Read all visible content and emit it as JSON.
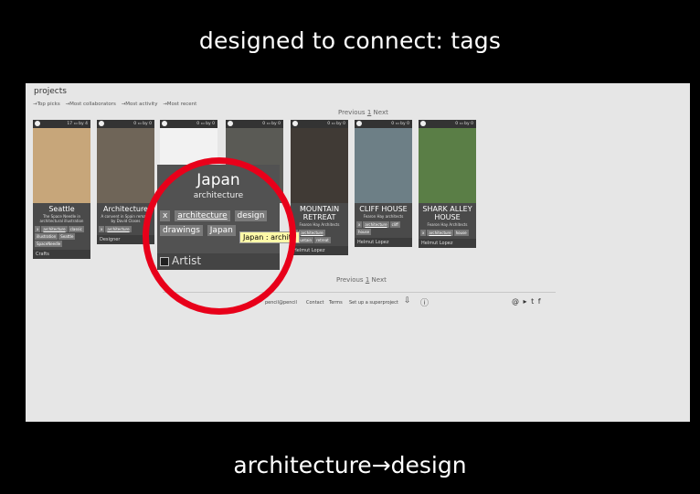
{
  "slide": {
    "title": "designed to connect: tags",
    "caption": "architecture→design"
  },
  "page": {
    "heading": "projects",
    "filters": [
      "→Top picks",
      "→Most collaborators",
      "→Most activity",
      "→Most recent"
    ],
    "pager": {
      "prev": "Previous",
      "page": "1",
      "next": "Next"
    }
  },
  "cards": [
    {
      "stats": "17 ▭ by 4",
      "name": "Seattle",
      "desc": "The Space Needle in architectural illustration",
      "tags": [
        "x",
        "architecture",
        "classic",
        "illustration",
        "Seattle",
        "SpaceNeedle"
      ],
      "foot": "Crafts",
      "img": "#c7a67a"
    },
    {
      "stats": "0 ▭ by 0",
      "name": "Architecture",
      "desc": "A convent in Spain remade by David Closes",
      "tags": [
        "x",
        "architecture"
      ],
      "foot": "Designer",
      "img": "#6f6558"
    },
    {
      "stats": "0 ▭ by 0",
      "name": "",
      "desc": "",
      "tags": [],
      "foot": "",
      "img": "#f2f2f2"
    },
    {
      "stats": "0 ▭ by 0",
      "name": "",
      "desc": "",
      "tags": [],
      "foot": "",
      "img": "#5a5a55"
    },
    {
      "stats": "0 ▭ by 0",
      "name": "MOUNTAIN RETREAT",
      "desc": "Fearon Hay Architects",
      "tags": [
        "x",
        "architecture",
        "mountain",
        "retreat"
      ],
      "foot": "Helmut Lopez",
      "img": "#403a35"
    },
    {
      "stats": "0 ▭ by 0",
      "name": "CLIFF HOUSE",
      "desc": "Fearon Hay architects",
      "tags": [
        "x",
        "architecture",
        "cliff",
        "house"
      ],
      "foot": "Helmut Lopez",
      "img": "#6d7f86"
    },
    {
      "stats": "0 ▭ by 0",
      "name": "SHARK ALLEY HOUSE",
      "desc": "Fearon Hay Architects",
      "tags": [
        "x",
        "architecture",
        "house"
      ],
      "foot": "Helmut Lopez",
      "img": "#5a7e46"
    }
  ],
  "zoom": {
    "name": "Japan",
    "subtitle": "architecture",
    "tags": [
      "x",
      "architecture",
      "design",
      "drawings",
      "Japan"
    ],
    "foot": "Artist",
    "tooltip": "Japan : archite"
  },
  "footer": {
    "links": [
      "pencil@pencil",
      "Contact",
      "Terms",
      "Set up a superproject"
    ],
    "social": "@ ▸ t f"
  }
}
